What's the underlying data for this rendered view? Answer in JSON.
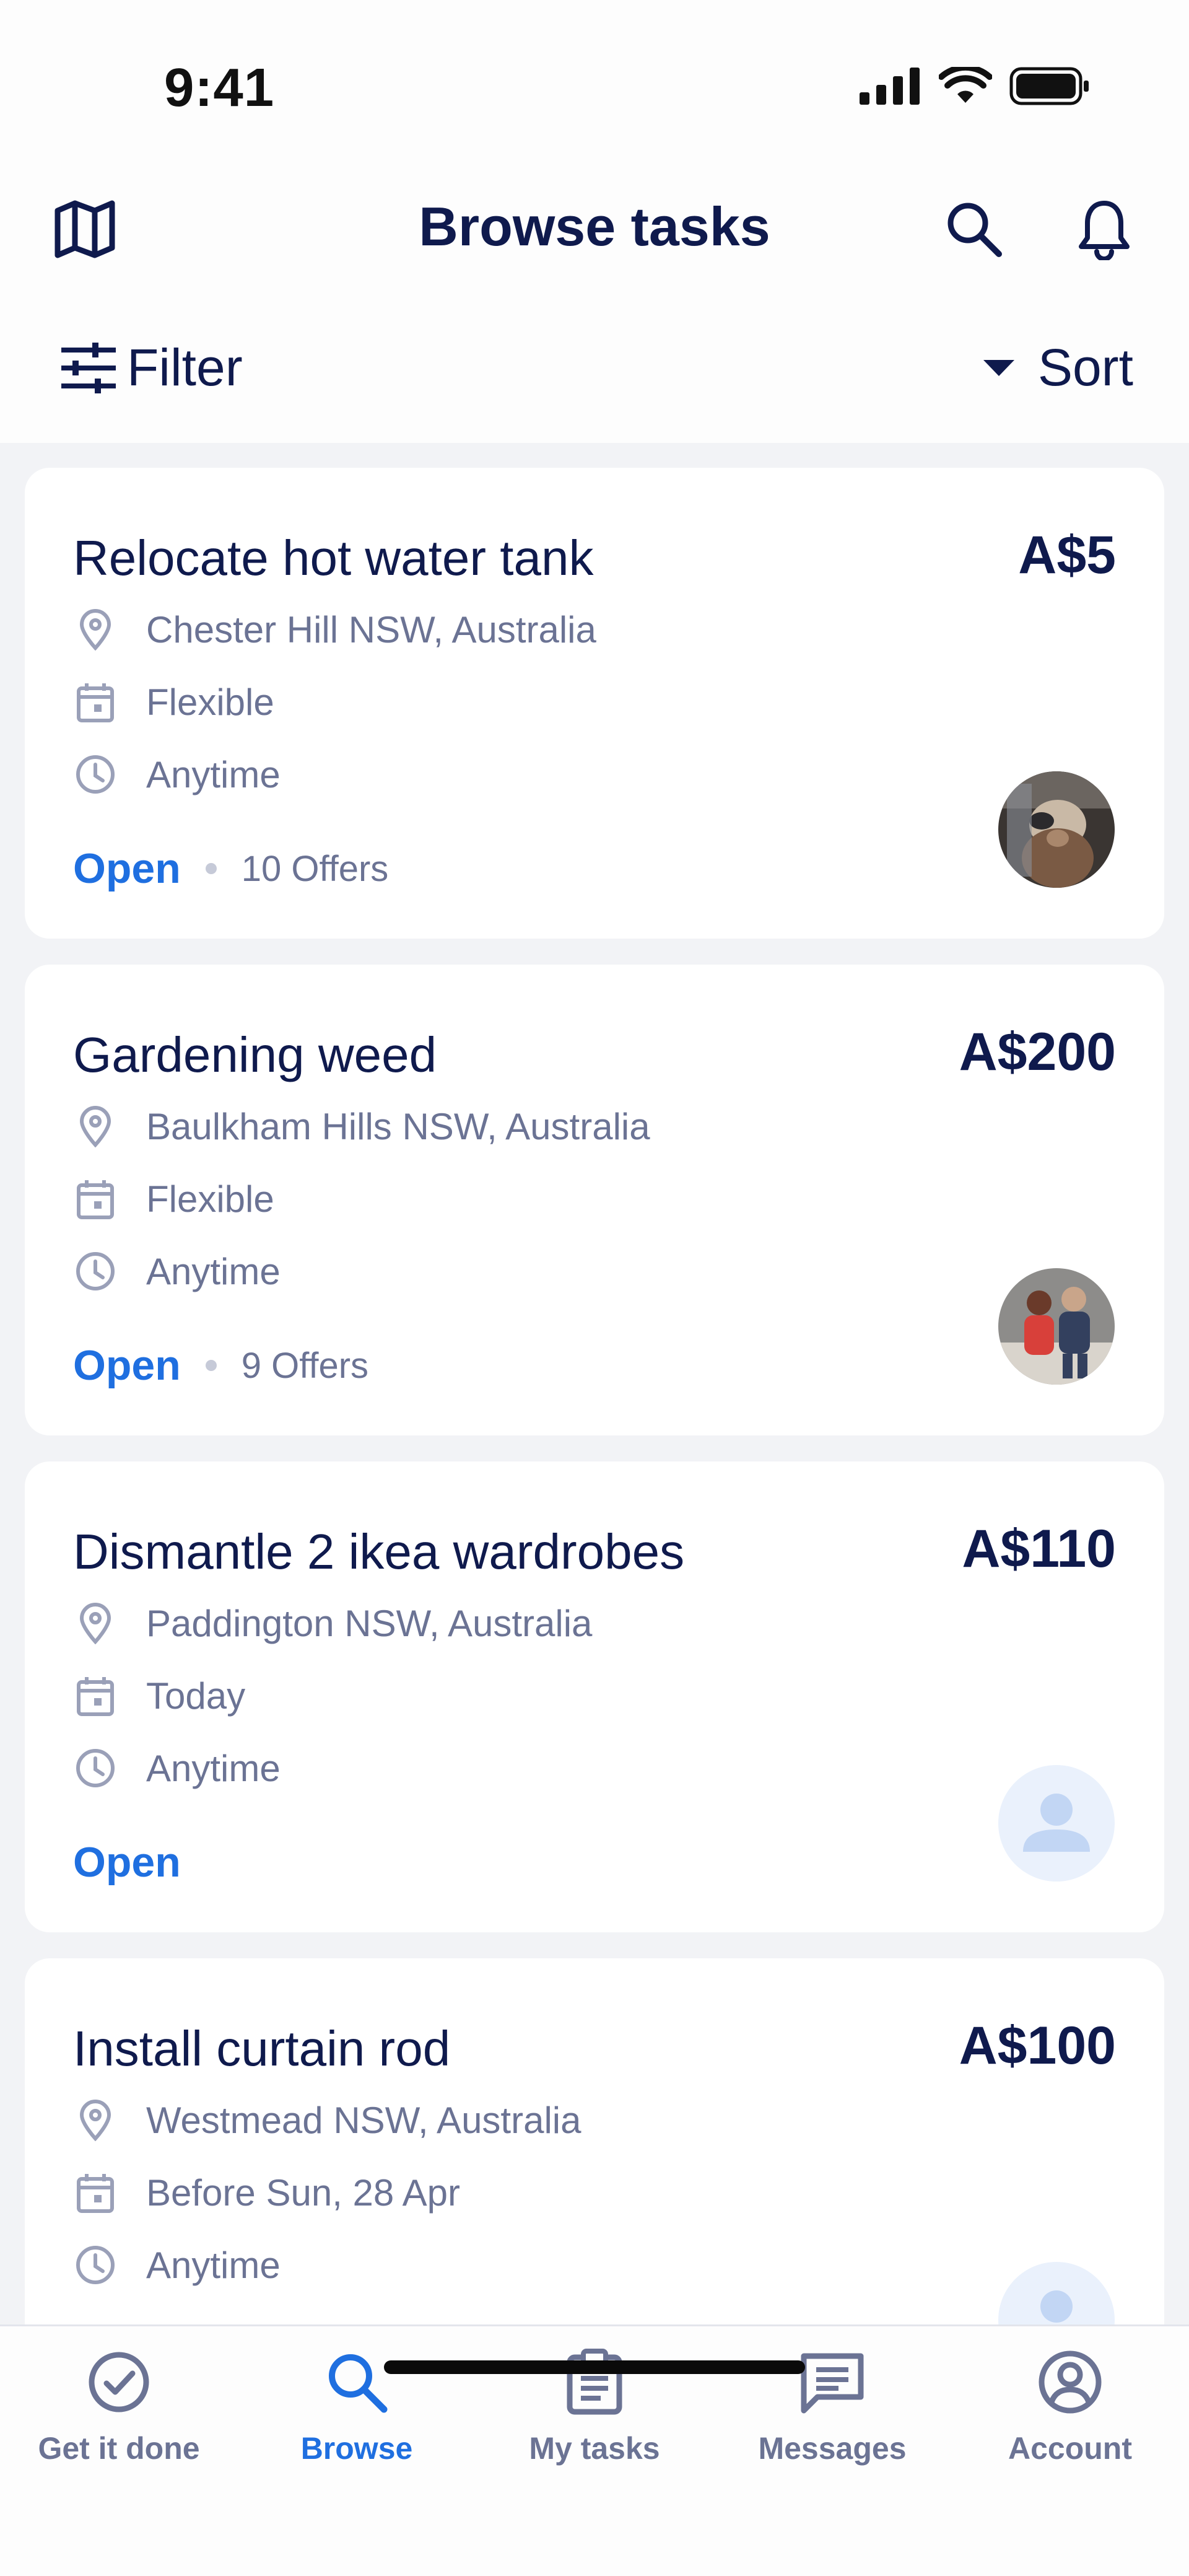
{
  "status_bar": {
    "time": "9:41"
  },
  "header": {
    "title": "Browse tasks"
  },
  "filters": {
    "filter_label": "Filter",
    "sort_label": "Sort"
  },
  "tasks": [
    {
      "title": "Relocate hot water tank",
      "price": "A$5",
      "location": "Chester Hill NSW, Australia",
      "date": "Flexible",
      "time": "Anytime",
      "status": "Open",
      "offers": "10 Offers"
    },
    {
      "title": "Gardening weed",
      "price": "A$200",
      "location": "Baulkham Hills NSW, Australia",
      "date": "Flexible",
      "time": "Anytime",
      "status": "Open",
      "offers": "9 Offers"
    },
    {
      "title": "Dismantle 2 ikea wardrobes",
      "price": "A$110",
      "location": "Paddington NSW, Australia",
      "date": "Today",
      "time": "Anytime",
      "status": "Open",
      "offers": ""
    },
    {
      "title": "Install curtain rod",
      "price": "A$100",
      "location": "Westmead NSW, Australia",
      "date": "Before Sun, 28 Apr",
      "time": "Anytime",
      "status": "",
      "offers": ""
    }
  ],
  "tabbar": {
    "items": [
      {
        "label": "Get it done",
        "icon": "check-circle-icon"
      },
      {
        "label": "Browse",
        "icon": "search-icon"
      },
      {
        "label": "My tasks",
        "icon": "clipboard-icon"
      },
      {
        "label": "Messages",
        "icon": "chat-icon"
      },
      {
        "label": "Account",
        "icon": "account-icon"
      }
    ]
  },
  "colors": {
    "primary": "#0f1a4d",
    "accent": "#1f6fe0",
    "muted": "#6b7394",
    "background": "#f2f3f6"
  }
}
